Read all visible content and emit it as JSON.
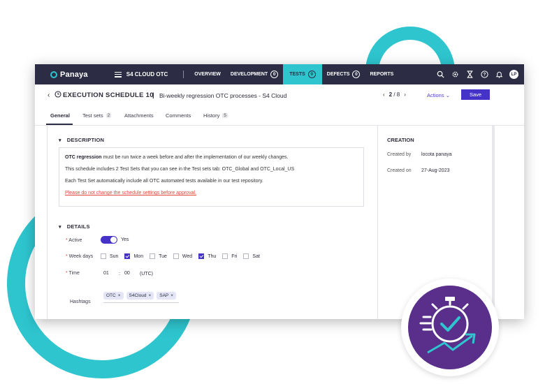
{
  "nav": {
    "brand": "Panaya",
    "project": "S4 CLOUD OTC",
    "items": [
      {
        "label": "OVERVIEW",
        "badge": null
      },
      {
        "label": "DEVELOPMENT",
        "badge": "0"
      },
      {
        "label": "TESTS",
        "badge": "0",
        "active": true
      },
      {
        "label": "DEFECTS",
        "badge": "0"
      },
      {
        "label": "REPORTS",
        "badge": null
      }
    ],
    "icons": [
      "search-icon",
      "gear-icon",
      "hourglass-icon",
      "help-icon",
      "bell-icon"
    ],
    "avatar": "LP"
  },
  "header": {
    "title": "EXECUTION SCHEDULE 10",
    "separator": "|",
    "subtitle": "Bi-weekly regression OTC processes - S4 Cloud",
    "page_current": "2",
    "page_total": "/ 8",
    "actions_label": "Actions",
    "save_label": "Save"
  },
  "tabs": [
    {
      "label": "General",
      "badge": null
    },
    {
      "label": "Test sets",
      "badge": "2"
    },
    {
      "label": "Attachments",
      "badge": null
    },
    {
      "label": "Comments",
      "badge": null
    },
    {
      "label": "History",
      "badge": "5"
    }
  ],
  "description": {
    "heading": "DESCRIPTION",
    "line1_bold": "OTC regression",
    "line1_rest": " must be run twice a week before and after the implementation of our weekly changes.",
    "line2": "This schedule includes 2 Test Sets that you can see in the Test sets tab: OTC_Global and OTC_Local_US",
    "line3": "Each Test Set automatically include all OTC automated tests available in our test repository.",
    "line4": "Please do not change the schedule settings before approval."
  },
  "details": {
    "heading": "DETAILS",
    "active_label": "Active",
    "active_value": "Yes",
    "weekdays_label": "Week days",
    "days": [
      {
        "label": "Sun",
        "checked": false
      },
      {
        "label": "Mon",
        "checked": true
      },
      {
        "label": "Tue",
        "checked": false
      },
      {
        "label": "Wed",
        "checked": false
      },
      {
        "label": "Thu",
        "checked": true
      },
      {
        "label": "Fri",
        "checked": false
      },
      {
        "label": "Sat",
        "checked": false
      }
    ],
    "time_label": "Time",
    "time_hour": "01",
    "time_colon": ":",
    "time_minute": "00",
    "time_zone": "(UTC)",
    "hashtags_label": "Hashtags",
    "tags": [
      "OTC",
      "S4Cloud",
      "SAP"
    ]
  },
  "creation": {
    "heading": "CREATION",
    "created_by_label": "Created by",
    "created_by": "locota panaya",
    "created_on_label": "Created on",
    "created_on": "27-Aug-2023"
  },
  "colors": {
    "accent": "#2ec5cf",
    "primary": "#4432c9",
    "nav_bg": "#2c2c44",
    "badge_bg": "#5a2f8c"
  }
}
